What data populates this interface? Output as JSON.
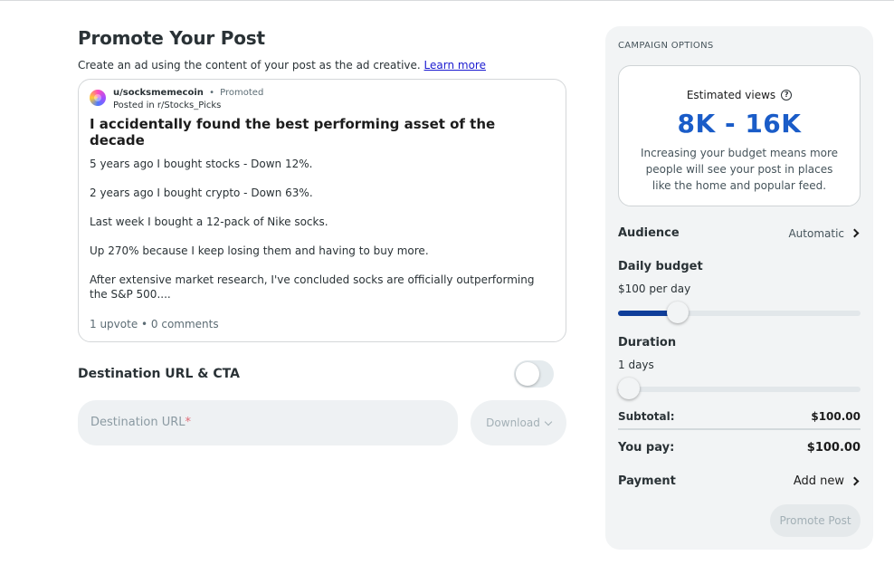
{
  "page": {
    "title": "Promote Your Post",
    "subtitle": "Create an ad using the content of your post as the ad creative.",
    "learn_more": "Learn more"
  },
  "post": {
    "username": "u/socksmemecoin",
    "dot": "•",
    "promoted": "Promoted",
    "posted_in": "Posted in r/Stocks_Picks",
    "title": "I accidentally found the best performing asset of the decade",
    "paragraphs": [
      "5 years ago I bought stocks - Down 12%.",
      "2 years ago I bought crypto - Down 63%.",
      "Last week I bought a 12-pack of Nike socks.",
      "Up 270% because I keep losing them and having to buy more.",
      "After extensive market research, I've concluded socks are officially outperforming the S&P 500...."
    ],
    "stats": "1 upvote • 0 comments"
  },
  "destination": {
    "label": "Destination URL & CTA",
    "toggle_on": false,
    "url_placeholder": "Destination URL",
    "required_mark": "*",
    "url_value": "",
    "cta_select": "Download"
  },
  "campaign": {
    "section_title": "CAMPAIGN OPTIONS",
    "estimate": {
      "label": "Estimated views",
      "value": "8K - 16K",
      "description": "Increasing your budget means more people will see your post in places like the home and popular feed."
    },
    "audience": {
      "label": "Audience",
      "value": "Automatic"
    },
    "daily_budget": {
      "label": "Daily budget",
      "value": "$100 per day",
      "slider_fraction": 0.22
    },
    "duration": {
      "label": "Duration",
      "value": "1 days",
      "slider_fraction": 0.0
    },
    "subtotal": {
      "label": "Subtotal:",
      "value": "$100.00"
    },
    "you_pay": {
      "label": "You pay:",
      "value": "$100.00"
    },
    "payment": {
      "label": "Payment",
      "value": "Add new"
    },
    "promote_button": "Promote Post"
  },
  "colors": {
    "accent_blue": "#1a5cc8",
    "slider_fill": "#0f3e9a",
    "link": "#1b1bd0",
    "panel_bg": "#f2f4f5"
  }
}
